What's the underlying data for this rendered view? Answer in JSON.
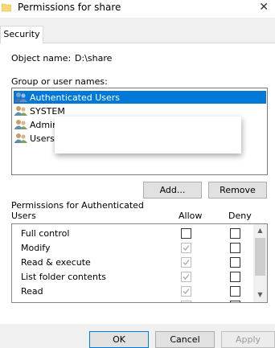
{
  "window": {
    "title": "Permissions for share",
    "close_glyph": "✕"
  },
  "tabs": [
    {
      "label": "Security"
    }
  ],
  "security": {
    "object_name_label": "Object name:",
    "object_name_value": "D:\\share",
    "group_label": "Group or user names:",
    "users": [
      {
        "name": "Authenticated Users",
        "selected": true
      },
      {
        "name": "SYSTEM",
        "selected": false
      },
      {
        "name": "Admini",
        "selected": false
      },
      {
        "name": "Users",
        "selected": false
      }
    ],
    "add_label": "Add...",
    "remove_label": "Remove",
    "perm_header_line1": "Permissions for Authenticated",
    "perm_header_line2": "Users",
    "allow_label": "Allow",
    "deny_label": "Deny",
    "permissions": [
      {
        "name": "Full control",
        "allow": false,
        "allow_disabled": false,
        "deny": false
      },
      {
        "name": "Modify",
        "allow": true,
        "allow_disabled": true,
        "deny": false
      },
      {
        "name": "Read & execute",
        "allow": true,
        "allow_disabled": true,
        "deny": false
      },
      {
        "name": "List folder contents",
        "allow": true,
        "allow_disabled": true,
        "deny": false
      },
      {
        "name": "Read",
        "allow": true,
        "allow_disabled": true,
        "deny": false
      },
      {
        "name": "",
        "allow": true,
        "allow_disabled": true,
        "deny": false
      }
    ]
  },
  "footer": {
    "ok_label": "OK",
    "cancel_label": "Cancel",
    "apply_label": "Apply"
  },
  "colors": {
    "selection": "#0078d7",
    "folder": "#f8d775",
    "disabled_check": "#a8a8a8"
  }
}
